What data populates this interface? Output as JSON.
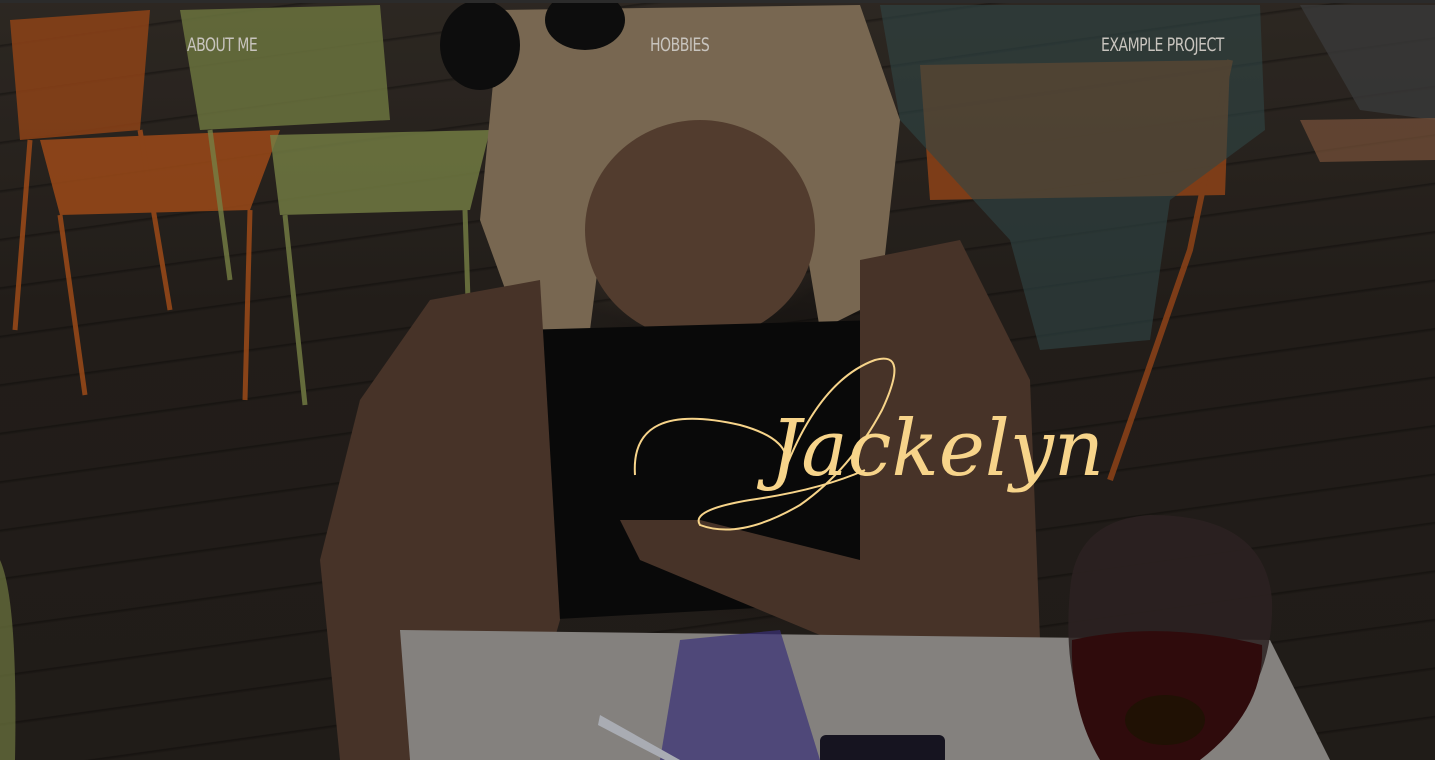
{
  "nav": {
    "items": [
      {
        "label": "ABOUT ME"
      },
      {
        "label": "HOBBIES"
      },
      {
        "label": "EXAMPLE PROJECT"
      }
    ]
  },
  "hero": {
    "signature": "Jackelyn",
    "signature_color": "#f7d48a"
  },
  "colors": {
    "nav_text": "#c8c4be",
    "overlay": "#000000"
  }
}
